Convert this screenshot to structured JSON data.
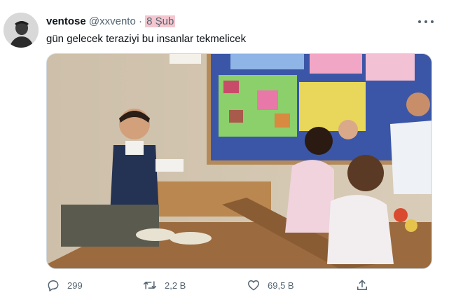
{
  "tweet": {
    "display_name": "ventose",
    "handle": "@xxvento",
    "separator": "·",
    "date": "8 Şub",
    "text": "gün gelecek teraziyi bu insanlar tekmelicek"
  },
  "actions": {
    "reply_count": "299",
    "retweet_count": "2,2 B",
    "like_count": "69,5 B"
  },
  "icons": [
    "avatar",
    "more-icon",
    "reply-icon",
    "retweet-icon",
    "like-icon",
    "share-icon"
  ],
  "colors": {
    "text_primary": "#0f1419",
    "text_secondary": "#536471",
    "date_highlight": "#f4c6cf",
    "border": "#cfd9de"
  }
}
